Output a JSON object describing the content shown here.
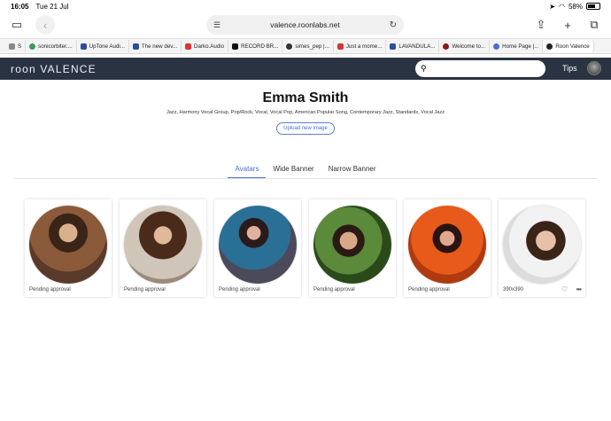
{
  "status": {
    "time": "16:05",
    "date": "Tue 21 Jul",
    "battery": "58%"
  },
  "browser": {
    "url": "valence.roonlabs.net",
    "tabs": [
      {
        "label": "S",
        "color": "#888"
      },
      {
        "label": "sonicorbiter....",
        "color": "#3a9a5a"
      },
      {
        "label": "UpTone Audi...",
        "color": "#2b4da0"
      },
      {
        "label": "The new dev...",
        "color": "#2b4da0"
      },
      {
        "label": "Darko.Audio",
        "color": "#d33"
      },
      {
        "label": "RECORD BR...",
        "color": "#111"
      },
      {
        "label": "simes_pep |...",
        "color": "#333"
      },
      {
        "label": "Just a mome...",
        "color": "#d33"
      },
      {
        "label": "LAVANDULA...",
        "color": "#2b4da0"
      },
      {
        "label": "Welcome to...",
        "color": "#8a1a1a"
      },
      {
        "label": "Home Page |...",
        "color": "#4a6fd0"
      },
      {
        "label": "Roon Valence",
        "color": "#222"
      }
    ]
  },
  "roon": {
    "logo": "roon VALENCE",
    "search_value": "",
    "tips_label": "Tips"
  },
  "artist": {
    "name": "Emma Smith",
    "genres": "Jazz, Harmony Vocal Group, Pop/Rock, Vocal, Vocal Pop, American Popular Song, Contemporary Jazz, Standards, Vocal Jazz",
    "upload_label": "Upload new image"
  },
  "subtabs": [
    {
      "label": "Avatars",
      "active": true
    },
    {
      "label": "Wide Banner",
      "active": false
    },
    {
      "label": "Narrow Banner",
      "active": false
    }
  ],
  "cards": [
    {
      "label": "Pending approval",
      "bg": "#5a3a2a"
    },
    {
      "label": "Pending approval",
      "bg": "#7a5a45"
    },
    {
      "label": "Pending approval",
      "bg": "#2d5f7a"
    },
    {
      "label": "Pending approval",
      "bg": "#4a7a2a"
    },
    {
      "label": "Pending approval",
      "bg": "#d9561e"
    },
    {
      "label": "390x390",
      "bg": "#ccc"
    }
  ]
}
